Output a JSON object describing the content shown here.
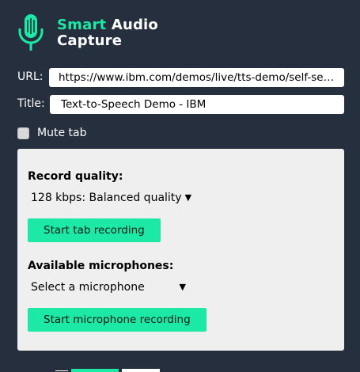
{
  "app": {
    "title_part1": "Smart",
    "title_part2": "Audio",
    "title_line2": "Capture",
    "accent_color": "#1de9a6",
    "logo_icon": "microphone-icon"
  },
  "fields": {
    "url_label": "URL:",
    "url_value": "https://www.ibm.com/demos/live/tts-demo/self-ser...",
    "title_label": "Title:",
    "title_value": "Text-to-Speech Demo - IBM"
  },
  "mute": {
    "label": "Mute tab",
    "checked": false
  },
  "record": {
    "quality_label": "Record quality:",
    "quality_selected": "128 kbps: Balanced quality",
    "start_tab_label": "Start tab recording"
  },
  "microphone": {
    "label": "Available microphones:",
    "selected": "Select a microphone",
    "start_mic_label": "Start microphone recording"
  }
}
